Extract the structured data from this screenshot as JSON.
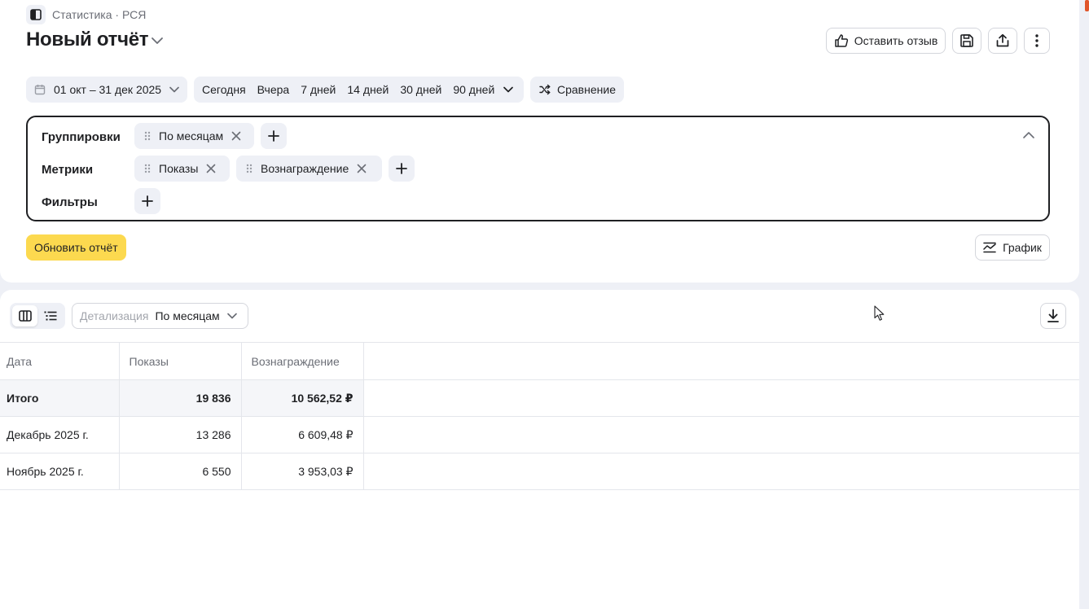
{
  "breadcrumb": {
    "text": "Статистика · РСЯ"
  },
  "header": {
    "title": "Новый отчёт",
    "feedback_label": "Оставить отзыв"
  },
  "date_range": {
    "value": "01 окт – 31 дек 2025",
    "quick_options": [
      "Сегодня",
      "Вчера",
      "7 дней",
      "14 дней",
      "30 дней",
      "90 дней"
    ],
    "compare_label": "Сравнение"
  },
  "config": {
    "groupings_label": "Группировки",
    "groupings": [
      "По месяцам"
    ],
    "metrics_label": "Метрики",
    "metrics": [
      "Показы",
      "Вознаграждение"
    ],
    "filters_label": "Фильтры"
  },
  "actions": {
    "update_label": "Обновить отчёт",
    "chart_label": "График"
  },
  "table_controls": {
    "detail_label": "Детализация",
    "detail_value": "По месяцам"
  },
  "table": {
    "columns": [
      "Дата",
      "Показы",
      "Вознаграждение"
    ],
    "total": {
      "label": "Итого",
      "impressions": "19 836",
      "reward": "10 562,52 ₽"
    },
    "rows": [
      {
        "date": "Декабрь 2025 г.",
        "impressions": "13 286",
        "reward": "6 609,48 ₽"
      },
      {
        "date": "Ноябрь 2025 г.",
        "impressions": "6 550",
        "reward": "3 953,03 ₽"
      }
    ]
  },
  "colors": {
    "accent_yellow": "#fcd94f",
    "chip_bg": "#eef0f6",
    "text": "#1f2023"
  }
}
